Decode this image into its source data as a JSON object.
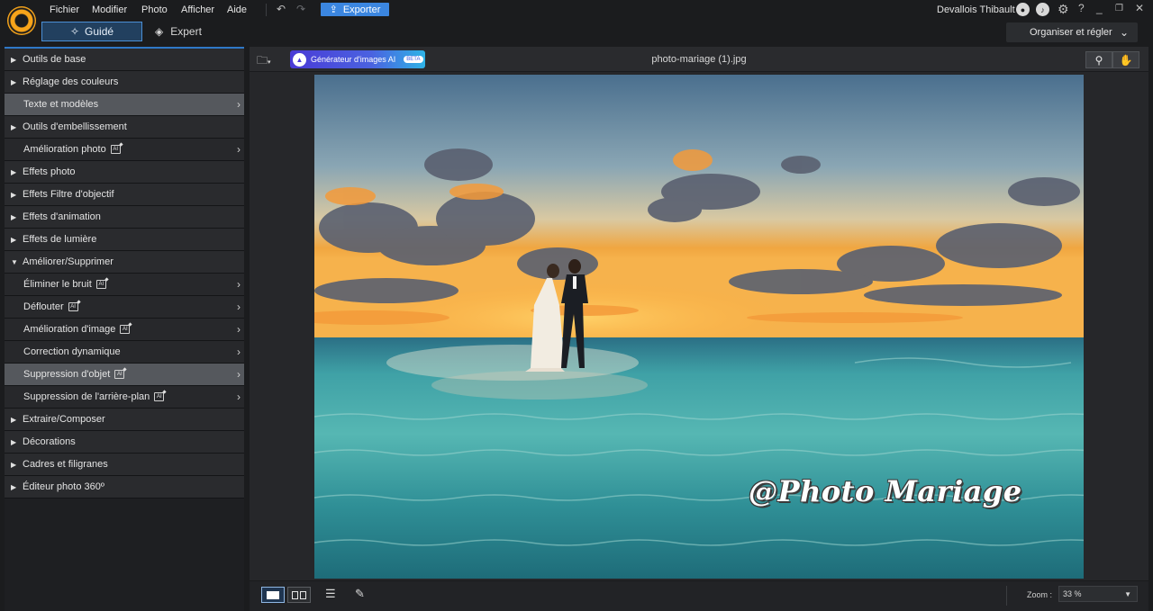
{
  "titlebar": {
    "menus": [
      "Fichier",
      "Modifier",
      "Photo",
      "Afficher",
      "Aide"
    ],
    "export_label": "Exporter",
    "user_name": "Devallois Thibault"
  },
  "modebar": {
    "guide_label": "Guidé",
    "expert_label": "Expert",
    "organize_label": "Organiser et régler"
  },
  "sidebar": {
    "items": [
      {
        "label": "Outils de base",
        "kind": "cat",
        "arrow": "right"
      },
      {
        "label": "Réglage des couleurs",
        "kind": "cat",
        "arrow": "right"
      },
      {
        "label": "Texte et modèles",
        "kind": "sub",
        "selected": true
      },
      {
        "label": "Outils d'embellissement",
        "kind": "cat",
        "arrow": "right"
      },
      {
        "label": "Amélioration photo",
        "kind": "sub",
        "ai": true
      },
      {
        "label": "Effets photo",
        "kind": "cat",
        "arrow": "right"
      },
      {
        "label": "Effets Filtre d'objectif",
        "kind": "cat",
        "arrow": "right"
      },
      {
        "label": "Effets d'animation",
        "kind": "cat",
        "arrow": "right"
      },
      {
        "label": "Effets de lumière",
        "kind": "cat",
        "arrow": "right"
      },
      {
        "label": "Améliorer/Supprimer",
        "kind": "cat",
        "arrow": "down"
      },
      {
        "label": "Éliminer le bruit",
        "kind": "sub",
        "ai": true
      },
      {
        "label": "Déflouter",
        "kind": "sub",
        "ai": true
      },
      {
        "label": "Amélioration d'image",
        "kind": "sub",
        "ai": true
      },
      {
        "label": "Correction dynamique",
        "kind": "sub"
      },
      {
        "label": "Suppression d'objet",
        "kind": "sub",
        "ai": true,
        "selected": true
      },
      {
        "label": "Suppression de l'arrière-plan",
        "kind": "sub",
        "ai": true
      },
      {
        "label": "Extraire/Composer",
        "kind": "cat",
        "arrow": "right"
      },
      {
        "label": "Décorations",
        "kind": "cat",
        "arrow": "right"
      },
      {
        "label": "Cadres et filigranes",
        "kind": "cat",
        "arrow": "right"
      },
      {
        "label": "Éditeur photo 360º",
        "kind": "cat",
        "arrow": "right"
      }
    ]
  },
  "canvas": {
    "ai_generator_label": "Générateur d'images AI",
    "beta_label": "BETA",
    "file_name": "photo-mariage (1).jpg",
    "watermark_text": "@Photo Mariage"
  },
  "bottombar": {
    "zoom_label": "Zoom :",
    "zoom_value": "33 %"
  },
  "colors": {
    "accent": "#3b86e0",
    "selected_row": "#55585d",
    "logo": "#f7a41a"
  }
}
